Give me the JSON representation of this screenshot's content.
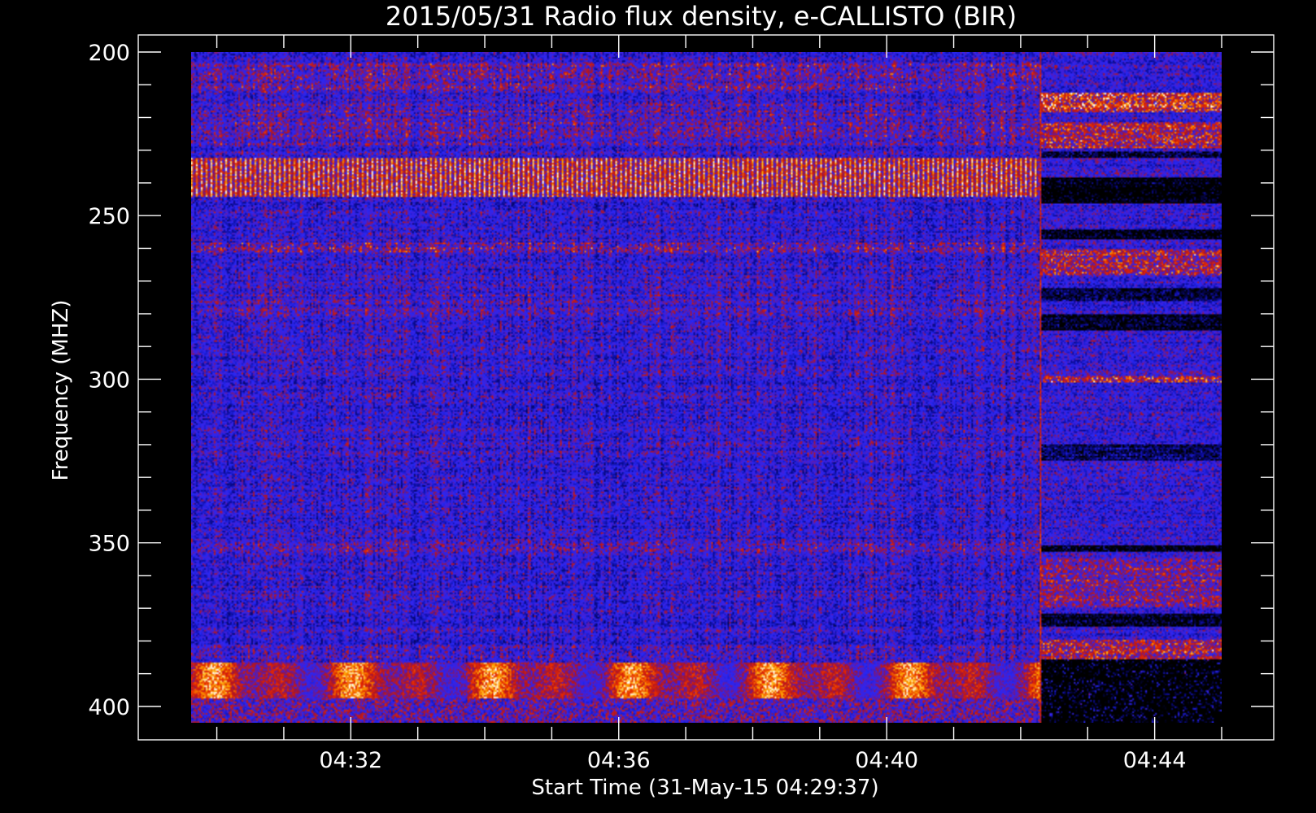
{
  "chart_data": {
    "type": "heatmap",
    "title": "2015/05/31  Radio flux density, e-CALLISTO (BIR)",
    "xlabel": "Start Time (31-May-15 04:29:37)",
    "ylabel": "Frequency (MHZ)",
    "ylim": [
      200,
      405
    ],
    "y_inverted": true,
    "xlim": [
      "04:29:37",
      "04:45:00"
    ],
    "x_tick_labels": [
      "04:32",
      "04:36",
      "04:40",
      "04:44"
    ],
    "y_tick_labels": [
      "200",
      "250",
      "300",
      "350",
      "400"
    ],
    "y_tick_values": [
      200,
      250,
      300,
      350,
      400
    ],
    "colormap": [
      "#000000",
      "#1010ff",
      "#b01010",
      "#ff3000",
      "#ffc000",
      "#ffffff"
    ],
    "features": [
      {
        "kind": "band",
        "freq_range_mhz": [
          232,
          244
        ],
        "time_range": [
          "04:29:37",
          "04:42:17"
        ],
        "intensity": "high"
      },
      {
        "kind": "band",
        "freq_range_mhz": [
          387,
          398
        ],
        "time_range": [
          "04:29:37",
          "04:42:17"
        ],
        "intensity": "high"
      },
      {
        "kind": "transition",
        "time": "04:42:17"
      }
    ]
  }
}
